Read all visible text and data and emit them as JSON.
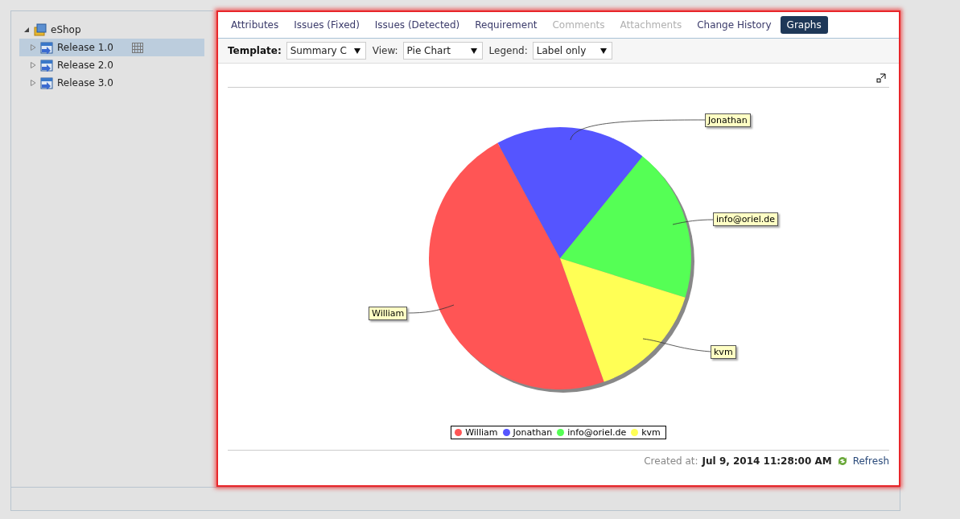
{
  "tree": [
    {
      "label": "eShop",
      "expanded": true,
      "selected": false,
      "children": [
        {
          "label": "Release 1.0",
          "expanded": false,
          "selected": true
        },
        {
          "label": "Release 2.0",
          "expanded": false,
          "selected": false
        },
        {
          "label": "Release 3.0",
          "expanded": false,
          "selected": false
        }
      ]
    }
  ],
  "tabs": [
    {
      "label": "Attributes",
      "selected": false,
      "disabled": false
    },
    {
      "label": "Issues (Fixed)",
      "selected": false,
      "disabled": false
    },
    {
      "label": "Issues (Detected)",
      "selected": false,
      "disabled": false
    },
    {
      "label": "Requirement",
      "selected": false,
      "disabled": false
    },
    {
      "label": "Comments",
      "selected": false,
      "disabled": true
    },
    {
      "label": "Attachments",
      "selected": false,
      "disabled": true
    },
    {
      "label": "Change History",
      "selected": false,
      "disabled": false
    },
    {
      "label": "Graphs",
      "selected": true,
      "disabled": false
    }
  ],
  "toolbar": [
    {
      "label": "Template:",
      "value": "Summary C",
      "bold": true
    },
    {
      "label": "View:",
      "value": "Pie Chart",
      "bold": false
    },
    {
      "label": "Legend:",
      "value": "Label only",
      "bold": false
    }
  ],
  "legend": [
    {
      "label": "William",
      "color": "#ff5555"
    },
    {
      "label": "Jonathan",
      "color": "#5555ff"
    },
    {
      "label": "info@oriel.de",
      "color": "#55ff55"
    },
    {
      "label": "kvm",
      "color": "#ffff55"
    }
  ],
  "slice_labels": [
    "William",
    "Jonathan",
    "info@oriel.de",
    "kvm"
  ],
  "footer": {
    "created_label": "Created at:",
    "created_value": "Jul 9, 2014 11:28:00 AM",
    "refresh": "Refresh"
  }
}
